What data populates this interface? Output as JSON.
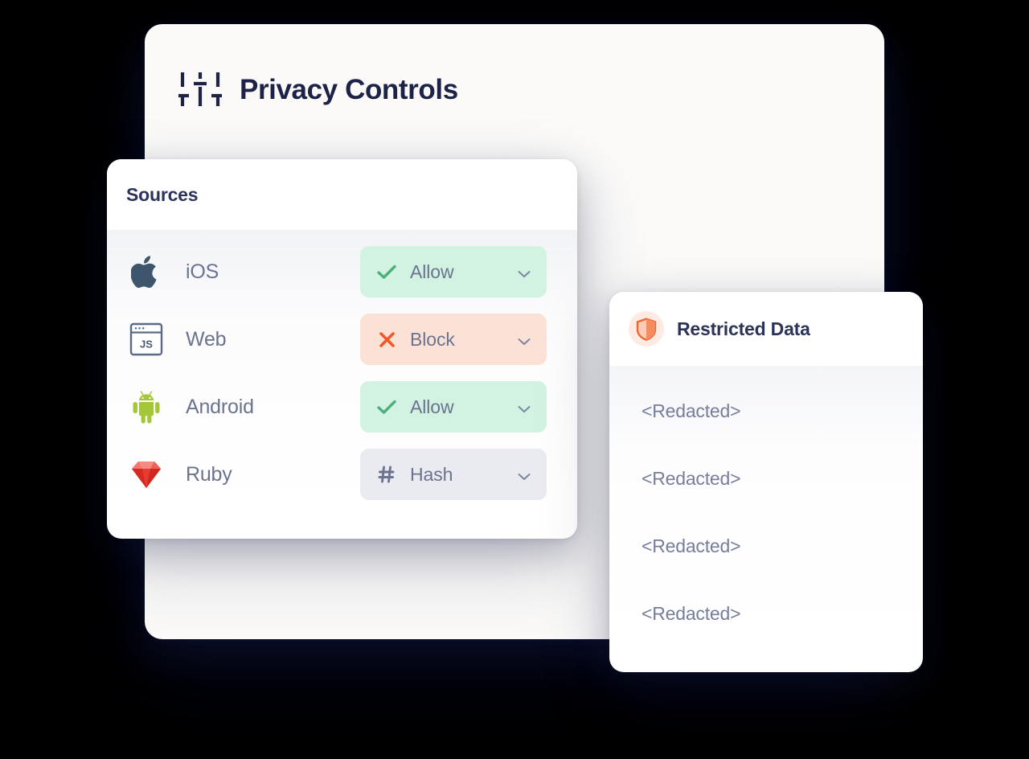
{
  "main_card": {
    "title": "Privacy Controls",
    "icon": "sliders-icon"
  },
  "sources_panel": {
    "title": "Sources",
    "rows": [
      {
        "label": "iOS",
        "icon": "apple-icon",
        "status_label": "Allow",
        "status_glyph": "check-icon",
        "status_kind": "allow",
        "chevron": "chevron-down-icon"
      },
      {
        "label": "Web",
        "icon": "js-browser-icon",
        "status_label": "Block",
        "status_glyph": "x-icon",
        "status_kind": "block",
        "chevron": "chevron-down-icon"
      },
      {
        "label": "Android",
        "icon": "android-icon",
        "status_label": "Allow",
        "status_glyph": "check-icon",
        "status_kind": "allow",
        "chevron": "chevron-down-icon"
      },
      {
        "label": "Ruby",
        "icon": "ruby-gem-icon",
        "status_label": "Hash",
        "status_glyph": "hash-icon",
        "status_kind": "hash",
        "chevron": "chevron-down-icon"
      }
    ]
  },
  "restricted_panel": {
    "title": "Restricted Data",
    "icon": "shield-icon",
    "items": [
      {
        "value": "<Redacted>"
      },
      {
        "value": "<Redacted>"
      },
      {
        "value": "<Redacted>"
      },
      {
        "value": "<Redacted>"
      }
    ]
  },
  "colors": {
    "background": "#000000",
    "main_card_bg": "#fbfaf9",
    "panel_bg": "#ffffff",
    "title_text": "#1d2347",
    "panel_title_text": "#2c3358",
    "label_text": "#6b738f",
    "redacted_text": "#767e9c",
    "allow_bg": "#d2f2e2",
    "allow_accent": "#4caf7d",
    "block_bg": "#fbe1d6",
    "block_accent": "#f05a28",
    "hash_bg": "#e9ebf1",
    "hash_accent": "#6b738f",
    "shield_badge_bg": "#fdeae2",
    "shield_accent": "#ef6632",
    "apple_icon": "#3d566e",
    "android_icon": "#a4c639",
    "ruby_icon": "#e8352b"
  }
}
